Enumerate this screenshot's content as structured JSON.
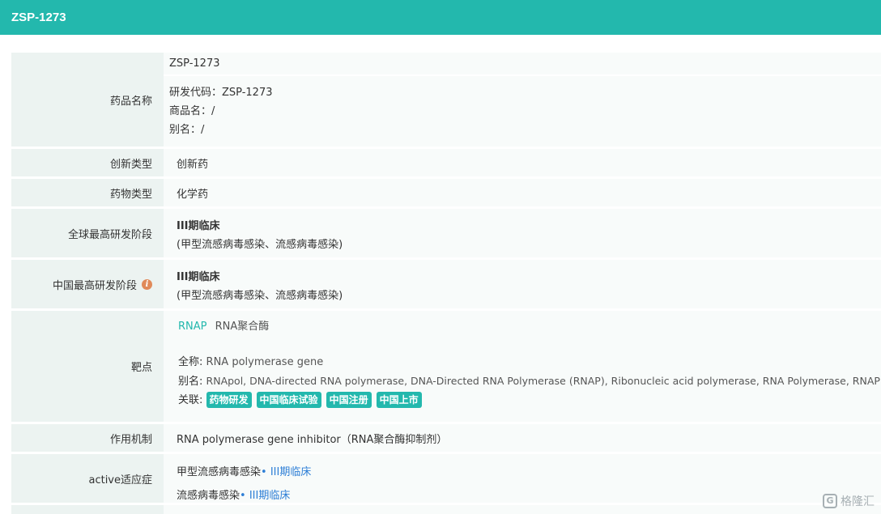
{
  "header": {
    "title": "ZSP-1273"
  },
  "rows": {
    "drug_name": {
      "label": "药品名称",
      "name": "ZSP-1273",
      "code": "研发代码：ZSP-1273",
      "trade": "商品名：/",
      "alias": "别名：/"
    },
    "innovation": {
      "label": "创新类型",
      "value": "创新药"
    },
    "drug_type": {
      "label": "药物类型",
      "value": "化学药"
    },
    "global_stage": {
      "label": "全球最高研发阶段",
      "stage": "III期临床",
      "indication": "(甲型流感病毒感染、流感病毒感染)"
    },
    "china_stage": {
      "label": "中国最高研发阶段",
      "info_icon": "i",
      "stage": "III期临床",
      "indication": "(甲型流感病毒感染、流感病毒感染)"
    },
    "target": {
      "label": "靶点",
      "target_code": "RNAP",
      "target_name": "RNA聚合酶",
      "fullname_label": "全称:",
      "fullname": "RNA polymerase gene",
      "alias_label": "别名:",
      "alias": "RNApol, DNA-directed RNA polymerase, DNA-Directed RNA Polymerase (RNAP), Ribonucleic acid polymerase, RNA Polymerase, RNAP",
      "related_label": "关联:",
      "tags": [
        "药物研发",
        "中国临床试验",
        "中国注册",
        "中国上市"
      ]
    },
    "mechanism": {
      "label": "作用机制",
      "value": "RNA polymerase gene inhibitor（RNA聚合酶抑制剂）"
    },
    "active": {
      "label": "active适应症",
      "items": [
        {
          "name": "甲型流感病毒感染",
          "stage": "• III期临床"
        },
        {
          "name": "流感病毒感染",
          "stage": "• III期临床"
        }
      ]
    }
  },
  "watermark": {
    "text": "格隆汇",
    "logo": "G"
  },
  "colors": {
    "accent": "#23b8ad",
    "link_blue": "#2d7ed6",
    "label_bg": "#ecf3f1",
    "value_bg": "#f8fbfa"
  }
}
